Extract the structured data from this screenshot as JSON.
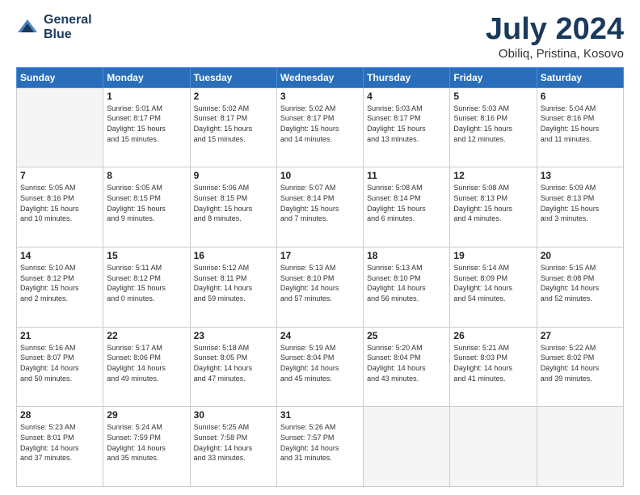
{
  "header": {
    "logo_line1": "General",
    "logo_line2": "Blue",
    "month_title": "July 2024",
    "location": "Obiliq, Pristina, Kosovo"
  },
  "weekdays": [
    "Sunday",
    "Monday",
    "Tuesday",
    "Wednesday",
    "Thursday",
    "Friday",
    "Saturday"
  ],
  "weeks": [
    [
      {
        "day": "",
        "info": ""
      },
      {
        "day": "1",
        "info": "Sunrise: 5:01 AM\nSunset: 8:17 PM\nDaylight: 15 hours\nand 15 minutes."
      },
      {
        "day": "2",
        "info": "Sunrise: 5:02 AM\nSunset: 8:17 PM\nDaylight: 15 hours\nand 15 minutes."
      },
      {
        "day": "3",
        "info": "Sunrise: 5:02 AM\nSunset: 8:17 PM\nDaylight: 15 hours\nand 14 minutes."
      },
      {
        "day": "4",
        "info": "Sunrise: 5:03 AM\nSunset: 8:17 PM\nDaylight: 15 hours\nand 13 minutes."
      },
      {
        "day": "5",
        "info": "Sunrise: 5:03 AM\nSunset: 8:16 PM\nDaylight: 15 hours\nand 12 minutes."
      },
      {
        "day": "6",
        "info": "Sunrise: 5:04 AM\nSunset: 8:16 PM\nDaylight: 15 hours\nand 11 minutes."
      }
    ],
    [
      {
        "day": "7",
        "info": "Sunrise: 5:05 AM\nSunset: 8:16 PM\nDaylight: 15 hours\nand 10 minutes."
      },
      {
        "day": "8",
        "info": "Sunrise: 5:05 AM\nSunset: 8:15 PM\nDaylight: 15 hours\nand 9 minutes."
      },
      {
        "day": "9",
        "info": "Sunrise: 5:06 AM\nSunset: 8:15 PM\nDaylight: 15 hours\nand 8 minutes."
      },
      {
        "day": "10",
        "info": "Sunrise: 5:07 AM\nSunset: 8:14 PM\nDaylight: 15 hours\nand 7 minutes."
      },
      {
        "day": "11",
        "info": "Sunrise: 5:08 AM\nSunset: 8:14 PM\nDaylight: 15 hours\nand 6 minutes."
      },
      {
        "day": "12",
        "info": "Sunrise: 5:08 AM\nSunset: 8:13 PM\nDaylight: 15 hours\nand 4 minutes."
      },
      {
        "day": "13",
        "info": "Sunrise: 5:09 AM\nSunset: 8:13 PM\nDaylight: 15 hours\nand 3 minutes."
      }
    ],
    [
      {
        "day": "14",
        "info": "Sunrise: 5:10 AM\nSunset: 8:12 PM\nDaylight: 15 hours\nand 2 minutes."
      },
      {
        "day": "15",
        "info": "Sunrise: 5:11 AM\nSunset: 8:12 PM\nDaylight: 15 hours\nand 0 minutes."
      },
      {
        "day": "16",
        "info": "Sunrise: 5:12 AM\nSunset: 8:11 PM\nDaylight: 14 hours\nand 59 minutes."
      },
      {
        "day": "17",
        "info": "Sunrise: 5:13 AM\nSunset: 8:10 PM\nDaylight: 14 hours\nand 57 minutes."
      },
      {
        "day": "18",
        "info": "Sunrise: 5:13 AM\nSunset: 8:10 PM\nDaylight: 14 hours\nand 56 minutes."
      },
      {
        "day": "19",
        "info": "Sunrise: 5:14 AM\nSunset: 8:09 PM\nDaylight: 14 hours\nand 54 minutes."
      },
      {
        "day": "20",
        "info": "Sunrise: 5:15 AM\nSunset: 8:08 PM\nDaylight: 14 hours\nand 52 minutes."
      }
    ],
    [
      {
        "day": "21",
        "info": "Sunrise: 5:16 AM\nSunset: 8:07 PM\nDaylight: 14 hours\nand 50 minutes."
      },
      {
        "day": "22",
        "info": "Sunrise: 5:17 AM\nSunset: 8:06 PM\nDaylight: 14 hours\nand 49 minutes."
      },
      {
        "day": "23",
        "info": "Sunrise: 5:18 AM\nSunset: 8:05 PM\nDaylight: 14 hours\nand 47 minutes."
      },
      {
        "day": "24",
        "info": "Sunrise: 5:19 AM\nSunset: 8:04 PM\nDaylight: 14 hours\nand 45 minutes."
      },
      {
        "day": "25",
        "info": "Sunrise: 5:20 AM\nSunset: 8:04 PM\nDaylight: 14 hours\nand 43 minutes."
      },
      {
        "day": "26",
        "info": "Sunrise: 5:21 AM\nSunset: 8:03 PM\nDaylight: 14 hours\nand 41 minutes."
      },
      {
        "day": "27",
        "info": "Sunrise: 5:22 AM\nSunset: 8:02 PM\nDaylight: 14 hours\nand 39 minutes."
      }
    ],
    [
      {
        "day": "28",
        "info": "Sunrise: 5:23 AM\nSunset: 8:01 PM\nDaylight: 14 hours\nand 37 minutes."
      },
      {
        "day": "29",
        "info": "Sunrise: 5:24 AM\nSunset: 7:59 PM\nDaylight: 14 hours\nand 35 minutes."
      },
      {
        "day": "30",
        "info": "Sunrise: 5:25 AM\nSunset: 7:58 PM\nDaylight: 14 hours\nand 33 minutes."
      },
      {
        "day": "31",
        "info": "Sunrise: 5:26 AM\nSunset: 7:57 PM\nDaylight: 14 hours\nand 31 minutes."
      },
      {
        "day": "",
        "info": ""
      },
      {
        "day": "",
        "info": ""
      },
      {
        "day": "",
        "info": ""
      }
    ]
  ]
}
